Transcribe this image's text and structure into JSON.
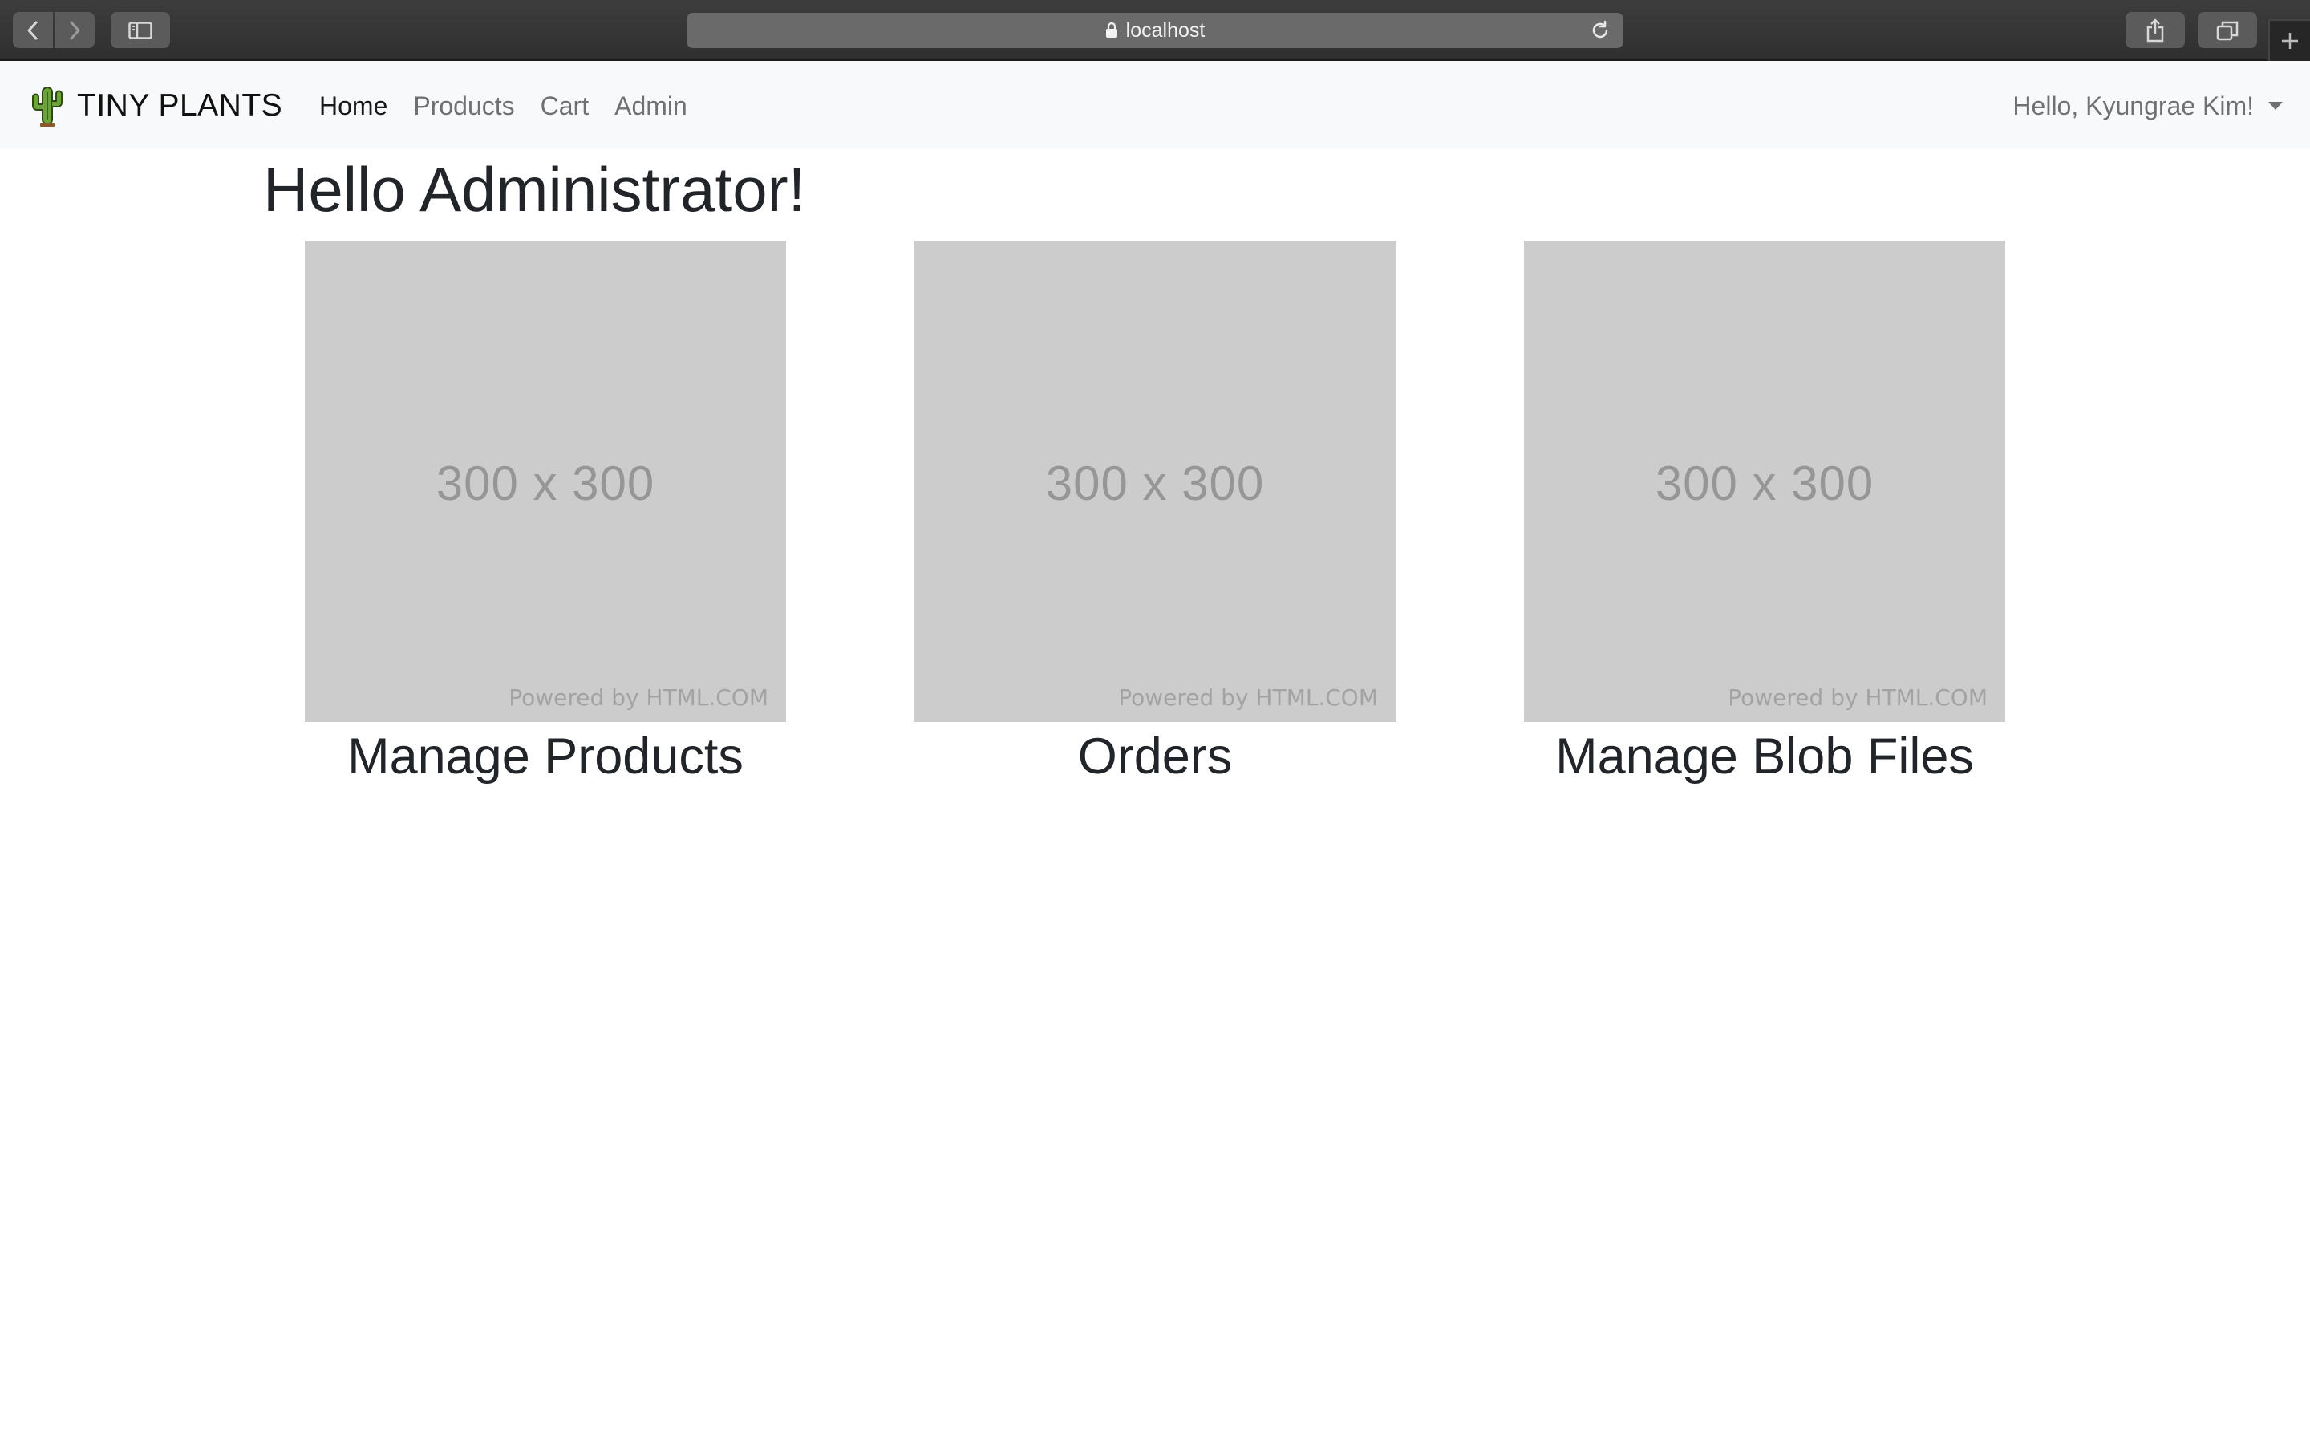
{
  "browser": {
    "url": "localhost"
  },
  "navbar": {
    "brand": "TINY PLANTS",
    "links": [
      {
        "label": "Home",
        "active": true
      },
      {
        "label": "Products",
        "active": false
      },
      {
        "label": "Cart",
        "active": false
      },
      {
        "label": "Admin",
        "active": false
      }
    ],
    "user_greeting": "Hello, Kyungrae Kim!"
  },
  "main": {
    "title": "Hello Administrator!",
    "cards": [
      {
        "image_text": "300 x 300",
        "image_credit": "Powered by HTML.COM",
        "title": "Manage Products"
      },
      {
        "image_text": "300 x 300",
        "image_credit": "Powered by HTML.COM",
        "title": "Orders"
      },
      {
        "image_text": "300 x 300",
        "image_credit": "Powered by HTML.COM",
        "title": "Manage Blob Files"
      }
    ]
  },
  "colors": {
    "navbar_bg": "#f8f9fa",
    "placeholder_bg": "#cccccc",
    "cactus_green": "#6ba539"
  }
}
